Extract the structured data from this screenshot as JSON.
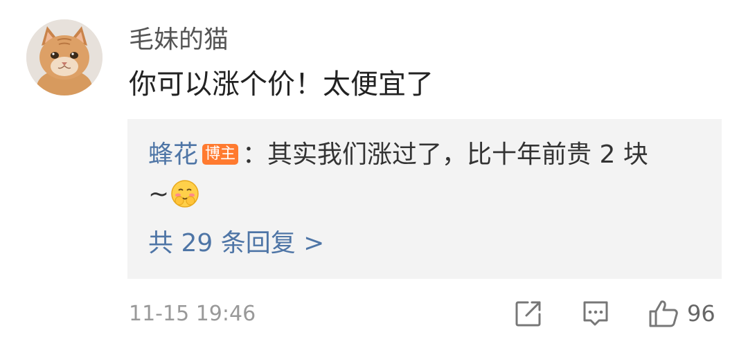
{
  "comment": {
    "username": "毛妹的猫",
    "text": "你可以涨个价！太便宜了",
    "timestamp": "11-15 19:46",
    "like_count": "96"
  },
  "reply": {
    "author": "蜂花",
    "badge": "博主",
    "line1": "：其实我们涨过了，比十年前贵 2 块",
    "line2_prefix": "~",
    "emoji": "shy-face-emoji",
    "more_label": "共 29 条回复 >"
  },
  "icons": {
    "share": "share-icon",
    "comment": "comment-icon",
    "like": "thumbs-up-icon"
  },
  "colors": {
    "link_blue": "#4e75a6",
    "badge_orange": "#ff7a2f",
    "reply_bg": "#f3f3f3",
    "meta_gray": "#999999"
  }
}
